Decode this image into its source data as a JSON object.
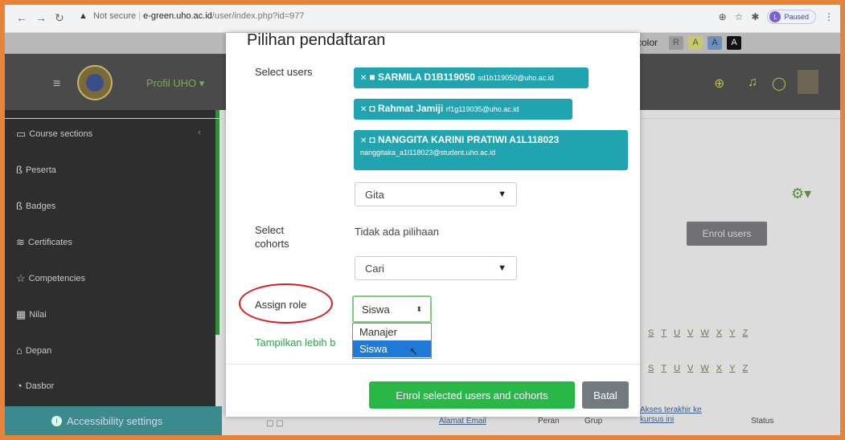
{
  "browser": {
    "not_secure": "Not secure",
    "url_host": "e-green.uho.ac.id",
    "url_path": "/user/index.php?id=977",
    "profile_initial": "L",
    "paused": "Paused"
  },
  "topbar": {
    "color_label": "color",
    "boxes": [
      "R",
      "A",
      "A",
      "A"
    ]
  },
  "navbar": {
    "site_name": "Profil UHO"
  },
  "sidebar": {
    "items": [
      {
        "label": "Course sections",
        "icon": "folder-icon"
      },
      {
        "label": "Peserta",
        "icon": "users-icon"
      },
      {
        "label": "Badges",
        "icon": "badges-icon"
      },
      {
        "label": "Certificates",
        "icon": "certificate-icon"
      },
      {
        "label": "Competencies",
        "icon": "star-icon"
      },
      {
        "label": "Nilai",
        "icon": "table-icon"
      },
      {
        "label": "Depan",
        "icon": "home-icon"
      },
      {
        "label": "Dasbor",
        "icon": "dashboard-icon"
      }
    ],
    "accessibility": "Accessibility settings"
  },
  "background": {
    "enrol_users": "Enrol users",
    "letters": [
      "S",
      "T",
      "U",
      "V",
      "W",
      "X",
      "Y",
      "Z"
    ],
    "col_email": "Alamat Email",
    "col_peran": "Peran",
    "col_grup": "Grup",
    "col_akses_1": "Akses terakhir ke",
    "col_akses_2": "kursus ini",
    "col_status": "Status"
  },
  "modal": {
    "title": "Pilihan pendaftaran",
    "select_users_label": "Select users",
    "users": [
      {
        "name": "SARMILA D1B119050",
        "email": "sd1b119050@uho.ac.id"
      },
      {
        "name": "Rahmat Jamiji",
        "email": "rf1g119035@uho.ac.id"
      },
      {
        "name": "NANGGITA KARINI PRATIWI A1L118023",
        "email": "nanggitaka_a1l118023@student.uho.ac.id"
      }
    ],
    "search_users_value": "Gita",
    "select_cohorts_label_1": "Select",
    "select_cohorts_label_2": "cohorts",
    "no_choice": "Tidak ada pilihaan",
    "search_cohorts_value": "Cari",
    "assign_role_label": "Assign role",
    "role_value": "Siswa",
    "role_options": [
      "Manajer",
      "Siswa"
    ],
    "show_more": "Tampilkan lebih b",
    "enrol_button": "Enrol selected users and cohorts",
    "cancel_button": "Batal"
  }
}
